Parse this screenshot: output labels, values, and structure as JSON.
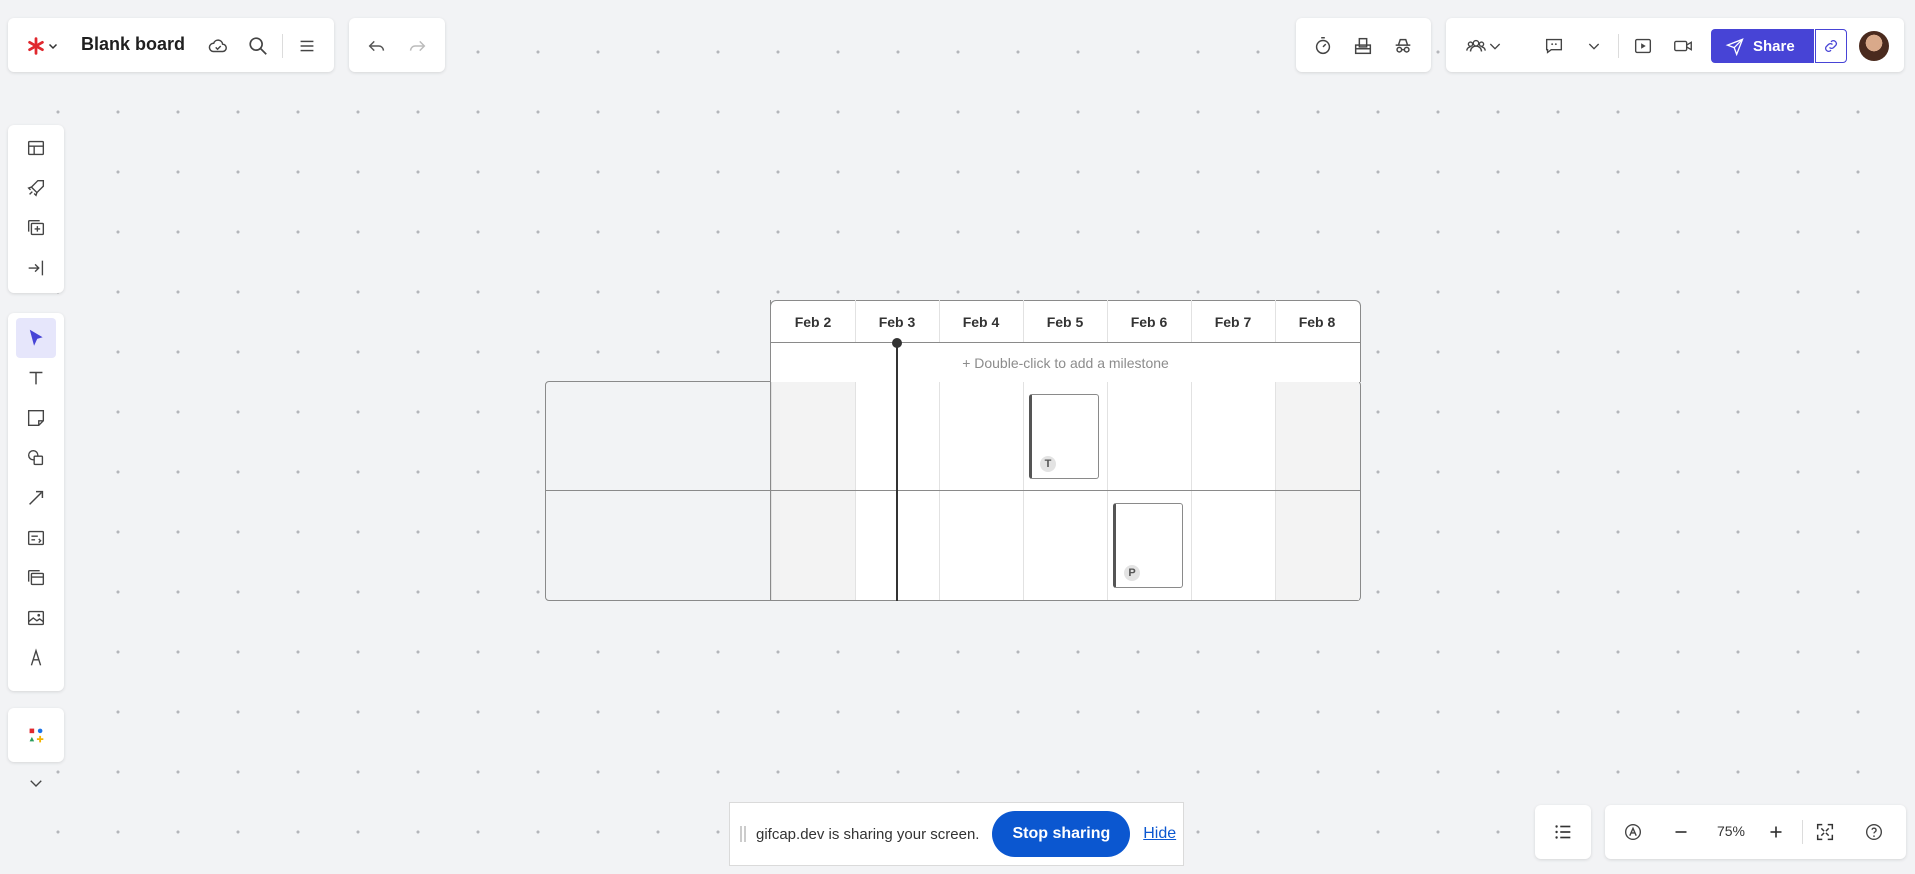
{
  "board": {
    "title": "Blank board"
  },
  "share": {
    "label": "Share"
  },
  "timeline": {
    "days": [
      "Feb 2",
      "Feb 3",
      "Feb 4",
      "Feb 5",
      "Feb 6",
      "Feb 7",
      "Feb 8"
    ],
    "milestone_hint": "+ Double-click to add a milestone",
    "cards": [
      {
        "badge": "T",
        "day": "Feb 5",
        "row": 1
      },
      {
        "badge": "P",
        "day": "Feb 6",
        "row": 2
      }
    ]
  },
  "sharing_bar": {
    "message": "gifcap.dev is sharing your screen.",
    "stop_label": "Stop sharing",
    "hide_label": "Hide"
  },
  "zoom": {
    "level": "75%"
  },
  "colors": {
    "brand": "#e0282e",
    "accent": "#4744d6",
    "stop_button": "#0b57d0"
  }
}
